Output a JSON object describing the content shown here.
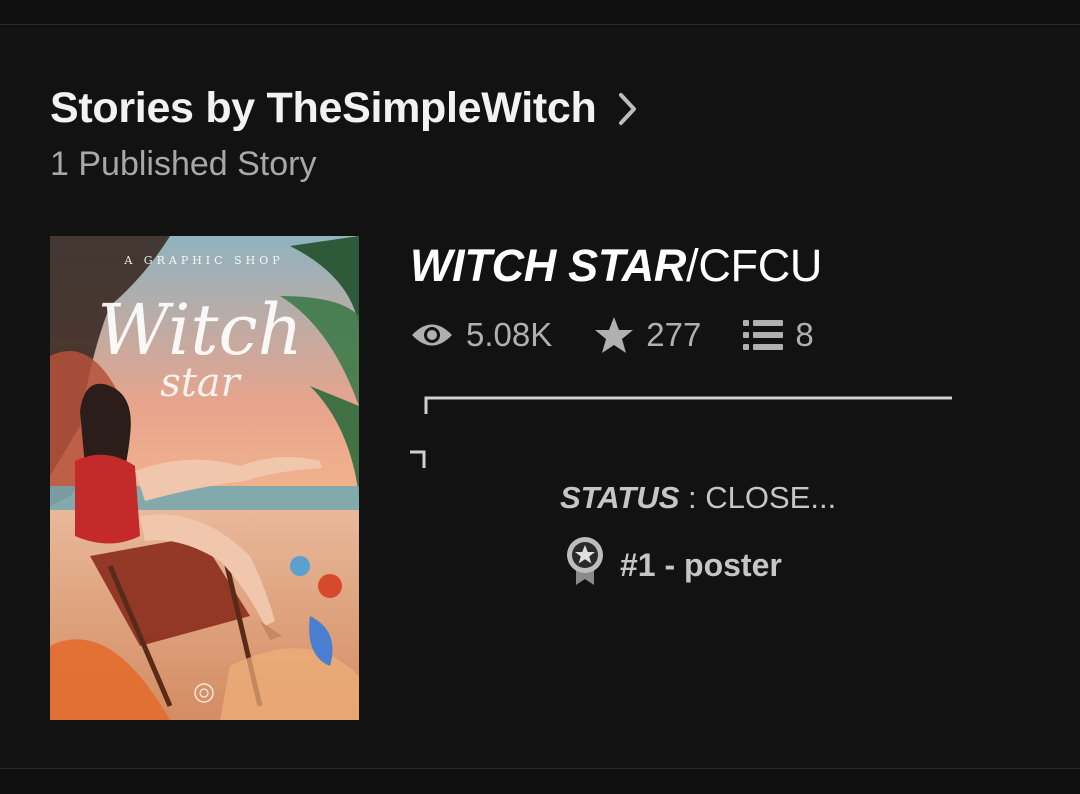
{
  "header": {
    "title": "Stories by TheSimpleWitch",
    "subtitle": "1 Published Story"
  },
  "story": {
    "title_emphasis": "WITCH STAR",
    "title_rest": "/CFCU",
    "stats": {
      "reads": "5.08K",
      "votes": "277",
      "parts": "8"
    },
    "description": {
      "status_key": "STATUS",
      "status_value": " : CLOSE...",
      "rank": "#1 - poster"
    },
    "cover": {
      "top_text": "A GRAPHIC SHOP",
      "script_line1": "Witch",
      "script_line2": "star"
    }
  },
  "colors": {
    "background": "#121212",
    "text_primary": "#f2f2f2",
    "text_secondary": "#a8a8a8",
    "icon_gray": "#b0b0b0"
  },
  "icons": [
    "chevron-right-icon",
    "eye-icon",
    "star-icon",
    "list-icon",
    "rank-badge-icon"
  ]
}
